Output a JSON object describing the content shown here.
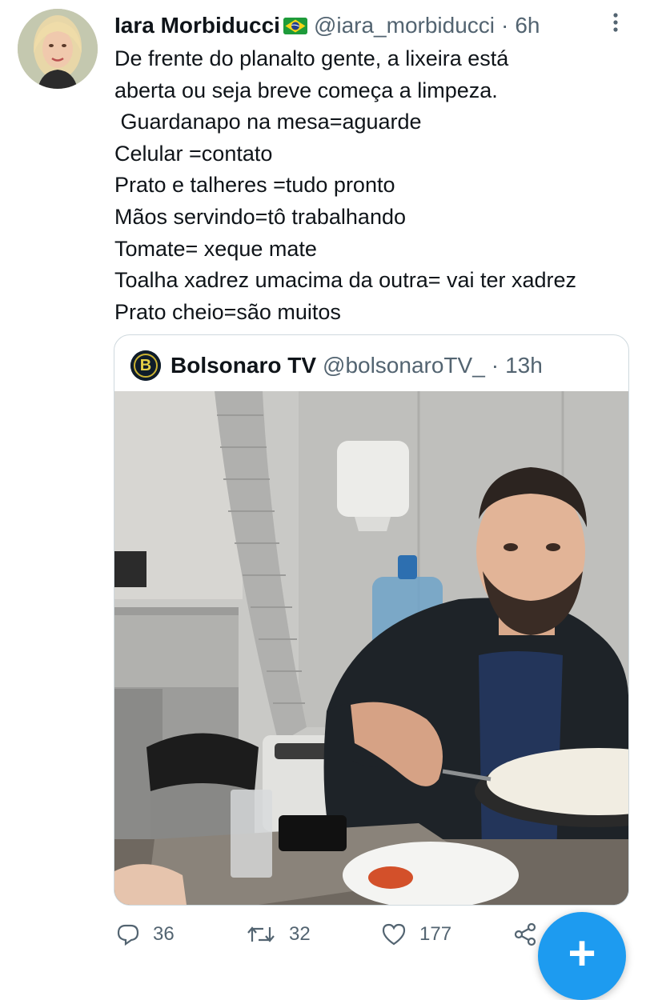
{
  "tweet": {
    "author_name": "Iara Morbiducci",
    "author_flag": "brazil-flag-emoji",
    "author_handle": "@iara_morbiducci",
    "separator": "·",
    "time": "6h",
    "text": "De frente do planalto gente, a lixeira está\naberta ou seja breve começa a limpeza.\n Guardanapo na mesa=aguarde\nCelular =contato\nPrato e talheres =tudo pronto\nMãos servindo=tô trabalhando\nTomate= xeque mate\nToalha xadrez umacima da outra= vai ter xadrez\nPrato cheio=são muitos"
  },
  "quoted": {
    "author_name": "Bolsonaro TV",
    "author_handle": "@bolsonaroTV_",
    "separator": "·",
    "time": "13h",
    "avatar_letter": "B"
  },
  "actions": {
    "replies": "36",
    "retweets": "32",
    "likes": "177"
  },
  "fab": {
    "label": "+"
  },
  "colors": {
    "accent": "#1d9bf0",
    "text": "#0f1419",
    "secondary": "#536471",
    "border": "#cfd9de"
  }
}
